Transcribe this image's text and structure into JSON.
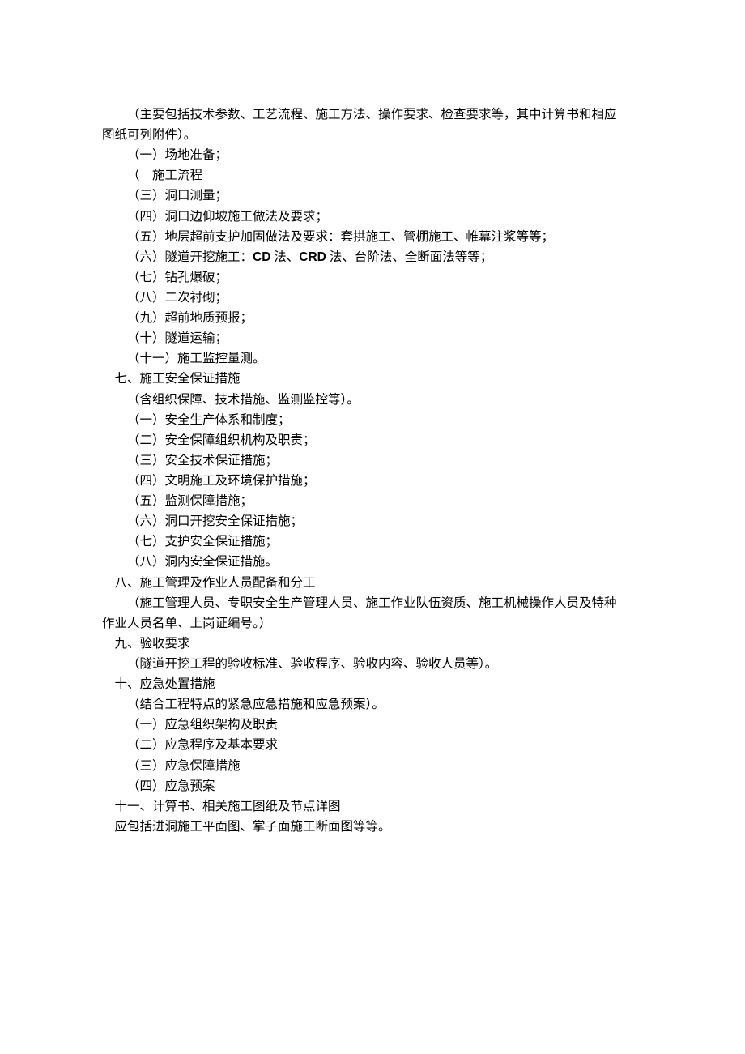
{
  "intro": {
    "l1": "（主要包括技术参数、工艺流程、施工方法、操作要求、检查要求等，其中计算书和相应",
    "l2": "图纸可列附件）。"
  },
  "six": {
    "i1": "（一）场地准备；",
    "i2a": "（",
    "i2b": "施工流程",
    "i3": "（三）洞口测量；",
    "i4": "（四）洞口边仰坡施工做法及要求；",
    "i5": "（五）地层超前支护加固做法及要求：套拱施工、管棚施工、帷幕注浆等等；",
    "i6_pre": "（六）隧道开挖施工：",
    "i6_cd": "CD",
    "i6_mid1": " 法、",
    "i6_crd": "CRD",
    "i6_mid2": " 法、台阶法、全断面法等等；",
    "i7": "（七）钻孔爆破；",
    "i8": "（八）二次衬砌；",
    "i9": "（九）超前地质预报；",
    "i10": "（十）隧道运输；",
    "i11": "（十一）施工监控量测。"
  },
  "seven": {
    "title": "七、施工安全保证措施",
    "note": "（含组织保障、技术措施、监测监控等）。",
    "i1": "（一）安全生产体系和制度；",
    "i2": "（二）安全保障组织机构及职责；",
    "i3": "（三）安全技术保证措施；",
    "i4": "（四）文明施工及环境保护措施；",
    "i5": "（五）监测保障措施；",
    "i6": "（六）洞口开挖安全保证措施；",
    "i7": "（七）支护安全保证措施；",
    "i8": "（八）洞内安全保证措施。"
  },
  "eight": {
    "title": "八、施工管理及作业人员配备和分工",
    "note_l1": "（施工管理人员、专职安全生产管理人员、施工作业队伍资质、施工机械操作人员及特种",
    "note_l2": "作业人员名单、上岗证编号。）"
  },
  "nine": {
    "title": "九、验收要求",
    "note": "（隧道开挖工程的验收标准、验收程序、验收内容、验收人员等）。"
  },
  "ten": {
    "title": "十、应急处置措施",
    "note": "（结合工程特点的紧急应急措施和应急预案）。",
    "i1": "（一）应急组织架构及职责",
    "i2": "（二）应急程序及基本要求",
    "i3": "（三）应急保障措施",
    "i4": "（四）应急预案"
  },
  "eleven": {
    "title": "十一、计算书、相关施工图纸及节点详图",
    "note": "应包括进洞施工平面图、掌子面施工断面图等等。"
  }
}
